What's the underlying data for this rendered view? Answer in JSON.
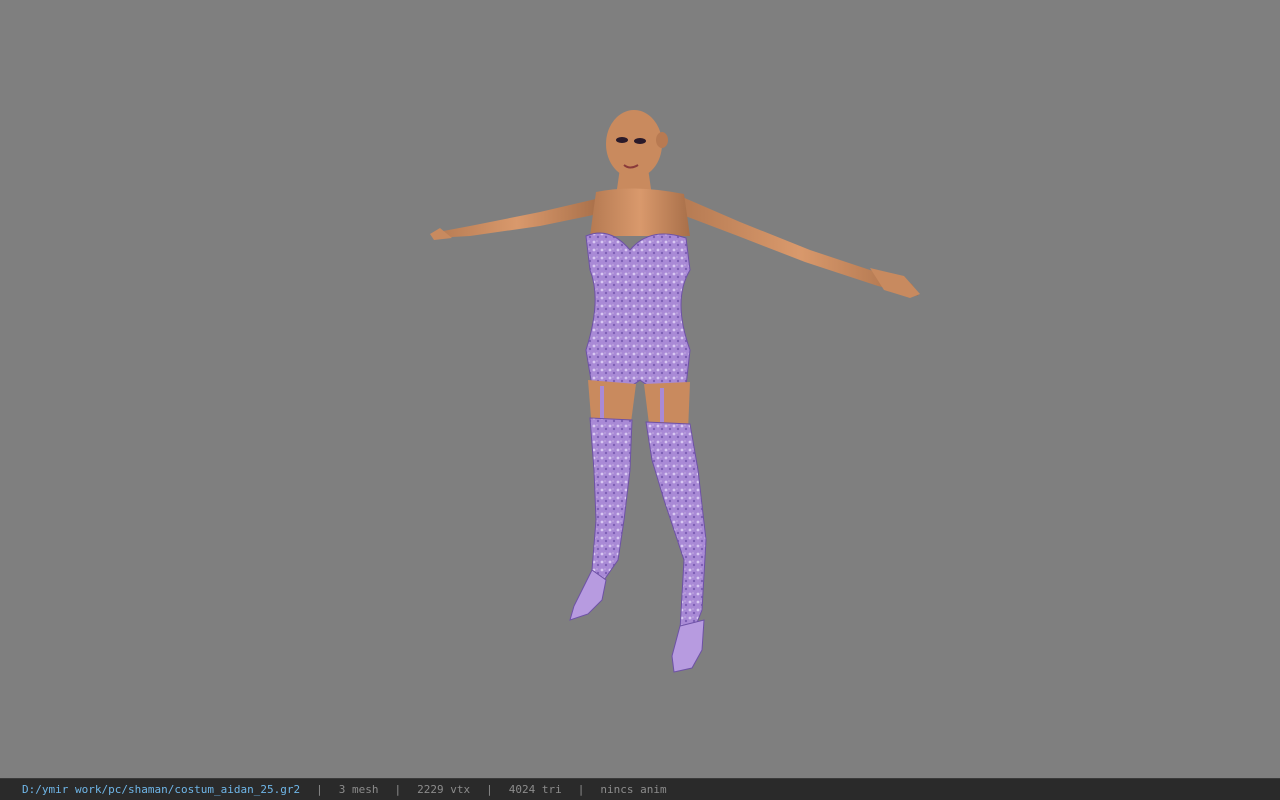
{
  "status_bar": {
    "file_path": "D:/ymir work/pc/shaman/costum_aidan_25.gr2",
    "separator": "|",
    "mesh_count": "3 mesh",
    "vertex_count": "2229 vtx",
    "triangle_count": "4024 tri",
    "anim_status": "nincs anim"
  },
  "colors": {
    "viewport_background": "#7f7f7f",
    "skin": "#c98a5e",
    "costume": "#a98ad6",
    "path_text": "#6fb6e8"
  }
}
